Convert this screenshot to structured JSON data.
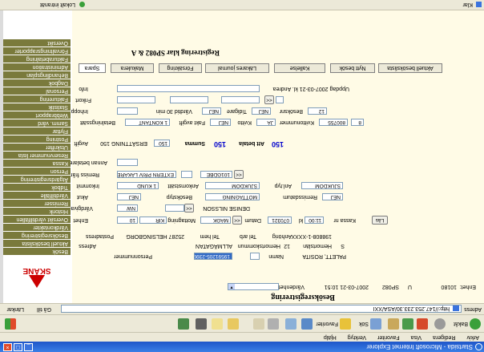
{
  "window": {
    "title": "Startsida - Microsoft Internet Explorer",
    "controls": [
      "_",
      "□",
      "×"
    ]
  },
  "menubar": [
    "Arkiv",
    "Redigera",
    "Visa",
    "Favoriter",
    "Verktyg",
    "Hjälp"
  ],
  "toolbar": {
    "back_label": "Bakåt",
    "search_label": "Sök",
    "favorites_label": "Favoriter"
  },
  "addressbar": {
    "label": "Adress",
    "url": "http://147.253.233.30/ASA/XXI",
    "go_label": "Gå till",
    "links_label": "Länkar"
  },
  "status": {
    "left": "Klar",
    "right": "Lokalt intranät"
  },
  "logo": {
    "text": "SKÅNE"
  },
  "sidebar": [
    "Besök",
    "Aktuell besökslista",
    "Besöksregistrering",
    "Vårdkontakter",
    "Översikt vårdtillfällen",
    "Historik",
    "Remisser",
    "Vårdtillfälle",
    "Tidbok",
    "Åtgärdsregistrering",
    "Person",
    "Kassa",
    "Reservnummer lista",
    "Utskrifter",
    "Postning",
    "Flyttar",
    "Samm. vård",
    "Webbrapport",
    "Statistik",
    "Fakturering",
    "Personal",
    "Dagbok",
    "Behandlingsplan",
    "Administration",
    "Fakturabetalning",
    "Förvaltningsrapporter",
    "Översikt"
  ],
  "header": {
    "title": "Besöksregistrering",
    "enhet_label": "Enhet:",
    "enhet_value": "10180",
    "vc_label": "U",
    "vc_value": "SP082",
    "datetime": "2007-03-21 10:51",
    "vardenhet_label": "Vårdenhet"
  },
  "patient": {
    "personnummer_label": "Personnummer",
    "personnummer_value": "19591205-2399",
    "name_label": "Namn",
    "name_value": "PALETT, ROSITA",
    "adress_label": "Adress",
    "adress_value": "ALLMÄGATAN",
    "postadress_label": "Postadress",
    "postadress_value": "25287 HELSINGBORG",
    "telhem_label": "Tel hem",
    "telarb_label": "Tel arb",
    "hemortskommun_label": "Hemortskommun",
    "hemortskommun_value": "12",
    "hemortslan_label": "Hemortslän",
    "hemortslan_value": "S",
    "anhorig_label": "Anhörig",
    "anhorig_value": "198808-1-XXXX",
    "btn_label": "Sök"
  },
  "form": {
    "enhet_label": "Enhet",
    "enhet_value": "10",
    "enhet_code": "KIR",
    "mottagning_label": "Mottagning",
    "mottagning_value": "MAGK",
    "datum_label": "Datum",
    "datum_value": "070321",
    "kl_label": "kl",
    "kl_value": "11:00",
    "kassa_label": "Kassa nr",
    "las_button": "Läs",
    "vardgivare_label": "Vårdgivare",
    "vardgivare_value": "NW",
    "vardgivare_name": "DENISE NILSSON",
    "akut_label": "Akut",
    "akut_value": "NEJ",
    "besokstyp_label": "Besökstyp",
    "besokstyp_value": "MOTTAGNING",
    "remissdatum_label": "Remissdatum",
    "remissdatum_value": "NEJ",
    "inkommit_label": "Inkommit",
    "inkommit_value": "1 KUND",
    "ankomstsatt_label": "Ankomstsätt",
    "ankomstsatt_value": "SJUKDOM",
    "ankomst_label": "Anl.typ",
    "ankomst_value": "SJUKDOM",
    "remiss_label": "Remiss från",
    "remiss_value": "EXTERN PRIV LÄKARE",
    "remiss_code": "101GDBE",
    "annan_label": "Annan betalare",
    "avgift_label": "Avgift",
    "avgift_value": "ERSÄTTNING 150",
    "avgift_sum": "150",
    "summa_label": "Summa",
    "summa_value": "150",
    "att_betala_label": "Att betala",
    "att_betala_value": "150",
    "betalningssatt_label": "Betalningssätt",
    "betalningssatt_value": "1 KONTANT",
    "fakt_avgift_label": "Fakt avgift",
    "fakt_avgift_value": "NEJ",
    "kvitto_label": "Kvitto",
    "kvitto_value": "JA",
    "kvittonummer_label": "Kvittonummer",
    "kvittonummer_value": "800755",
    "kvitto_extra": "8",
    "frikort_label": "Frikort",
    "inhoppare_label": "Inhopp",
    "vardtid_label": "Vårdtid 30 min",
    "vardtid_value": "NEJ",
    "tidigare_label": "Tidigare",
    "tidigare_value": "NEJ",
    "besoksnummer_label": "Besöksnr",
    "besoksnummer_value": "12",
    "info_label": "Info",
    "uppdaterad_label": "Uppdag 2007-03-21 kl. Andrea"
  },
  "tabs": [
    "Spara",
    "Makulera",
    "Försäkring",
    "Läkares journal",
    "Kallelse",
    "Nytt besök",
    "Aktuell besökslista"
  ],
  "subtitle": "Registrering klar SP082 & A"
}
